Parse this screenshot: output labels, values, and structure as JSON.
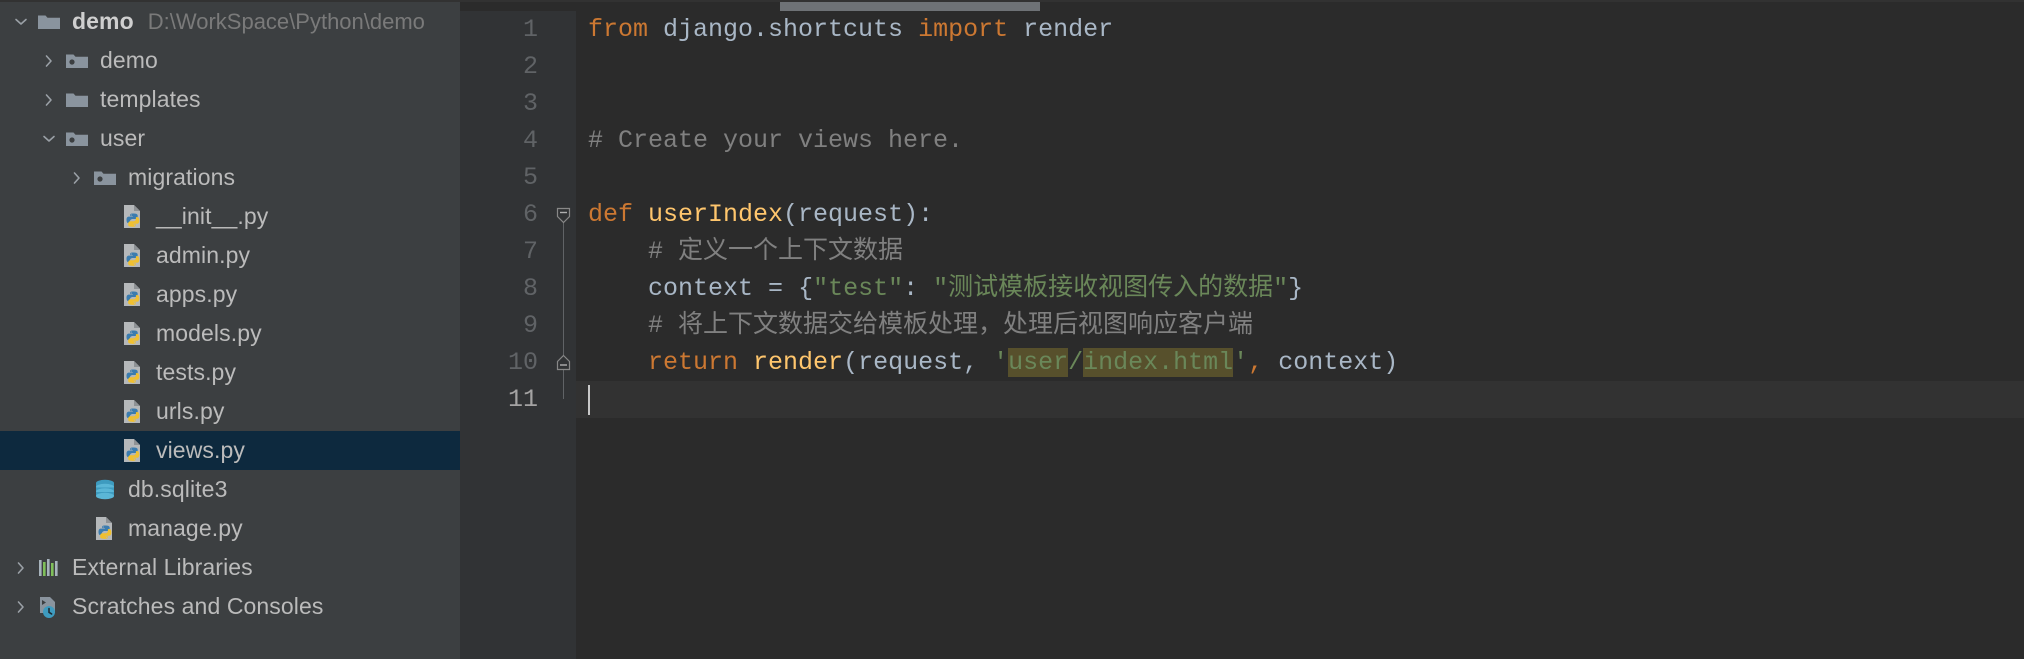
{
  "project_tree": {
    "rows": [
      {
        "depth": 0,
        "arrow": "down",
        "icon": "folder-icon",
        "label": "demo",
        "sublabel": "D:\\WorkSpace\\Python\\demo",
        "root": true,
        "selected": false
      },
      {
        "depth": 1,
        "arrow": "right",
        "icon": "module-folder-icon",
        "label": "demo",
        "sublabel": "",
        "root": false,
        "selected": false
      },
      {
        "depth": 1,
        "arrow": "right",
        "icon": "folder-icon",
        "label": "templates",
        "sublabel": "",
        "root": false,
        "selected": false
      },
      {
        "depth": 1,
        "arrow": "down",
        "icon": "module-folder-icon",
        "label": "user",
        "sublabel": "",
        "root": false,
        "selected": false
      },
      {
        "depth": 2,
        "arrow": "right",
        "icon": "module-folder-icon",
        "label": "migrations",
        "sublabel": "",
        "root": false,
        "selected": false
      },
      {
        "depth": 3,
        "arrow": "none",
        "icon": "python-file-icon",
        "label": "__init__.py",
        "sublabel": "",
        "root": false,
        "selected": false
      },
      {
        "depth": 3,
        "arrow": "none",
        "icon": "python-file-icon",
        "label": "admin.py",
        "sublabel": "",
        "root": false,
        "selected": false
      },
      {
        "depth": 3,
        "arrow": "none",
        "icon": "python-file-icon",
        "label": "apps.py",
        "sublabel": "",
        "root": false,
        "selected": false
      },
      {
        "depth": 3,
        "arrow": "none",
        "icon": "python-file-icon",
        "label": "models.py",
        "sublabel": "",
        "root": false,
        "selected": false
      },
      {
        "depth": 3,
        "arrow": "none",
        "icon": "python-file-icon",
        "label": "tests.py",
        "sublabel": "",
        "root": false,
        "selected": false
      },
      {
        "depth": 3,
        "arrow": "none",
        "icon": "python-file-icon",
        "label": "urls.py",
        "sublabel": "",
        "root": false,
        "selected": false
      },
      {
        "depth": 3,
        "arrow": "none",
        "icon": "python-file-icon",
        "label": "views.py",
        "sublabel": "",
        "root": false,
        "selected": true
      },
      {
        "depth": 2,
        "arrow": "none",
        "icon": "database-icon",
        "label": "db.sqlite3",
        "sublabel": "",
        "root": false,
        "selected": false
      },
      {
        "depth": 2,
        "arrow": "none",
        "icon": "python-file-icon",
        "label": "manage.py",
        "sublabel": "",
        "root": false,
        "selected": false
      },
      {
        "depth": 0,
        "arrow": "right",
        "icon": "libraries-icon",
        "label": "External Libraries",
        "sublabel": "",
        "root": false,
        "selected": false
      },
      {
        "depth": 0,
        "arrow": "right",
        "icon": "scratches-icon",
        "label": "Scratches and Consoles",
        "sublabel": "",
        "root": false,
        "selected": false
      }
    ]
  },
  "editor": {
    "file": "views.py",
    "language": "python",
    "current_line": 11,
    "gutter_numbers": [
      "1",
      "2",
      "3",
      "4",
      "5",
      "6",
      "7",
      "8",
      "9",
      "10",
      "11"
    ],
    "lines": [
      {
        "n": 1,
        "text": "from django.shortcuts import render"
      },
      {
        "n": 2,
        "text": ""
      },
      {
        "n": 3,
        "text": ""
      },
      {
        "n": 4,
        "text": "# Create your views here."
      },
      {
        "n": 5,
        "text": ""
      },
      {
        "n": 6,
        "text": "def userIndex(request):"
      },
      {
        "n": 7,
        "text": "    # 定义一个上下文数据"
      },
      {
        "n": 8,
        "text": "    context = {\"test\": \"测试模板接收视图传入的数据\"}"
      },
      {
        "n": 9,
        "text": "    # 将上下文数据交给模板处理，处理后视图响应客户端"
      },
      {
        "n": 10,
        "text": "    return render(request, 'user/index.html', context)"
      },
      {
        "n": 11,
        "text": ""
      }
    ],
    "tokens": {
      "l1": {
        "kw1": "from",
        "mod": " django.shortcuts ",
        "kw2": "import",
        "name": " render"
      },
      "l4": {
        "comment": "# Create your views here."
      },
      "l6": {
        "kw": "def",
        "fn": " userIndex",
        "rest": "(request):"
      },
      "l7": {
        "comment": "# 定义一个上下文数据"
      },
      "l8": {
        "name": "context ",
        "eq": "= ",
        "brace_open": "{",
        "key": "\"test\"",
        "colon": ": ",
        "value": "\"测试模板接收视图传入的数据\"",
        "brace_close": "}"
      },
      "l9": {
        "comment": "# 将上下文数据交给模板处理，处理后视图响应客户端"
      },
      "l10": {
        "kw": "return",
        "fn": " render",
        "p1": "(request, ",
        "q1": "'",
        "hl1": "user",
        "slash": "/",
        "hl2": "index.html",
        "q2": "'",
        "comma": ",",
        "arg": " context",
        "p2": ")"
      }
    },
    "fold_markers": [
      {
        "line": 6,
        "type": "fold-collapse-top"
      },
      {
        "line": 10,
        "type": "fold-collapse-bottom"
      }
    ],
    "colors": {
      "keyword": "#cc7832",
      "function": "#ffc66d",
      "string": "#6a8759",
      "comment": "#808080",
      "identifier": "#a9b7c6",
      "editor_bg": "#2b2b2b",
      "gutter_bg": "#313335",
      "sidebar_bg": "#3c3f41",
      "selection_bg": "#0d293e",
      "search_highlight": "#57502c"
    },
    "scrollbar": {
      "orientation": "horizontal",
      "position": "top"
    }
  }
}
